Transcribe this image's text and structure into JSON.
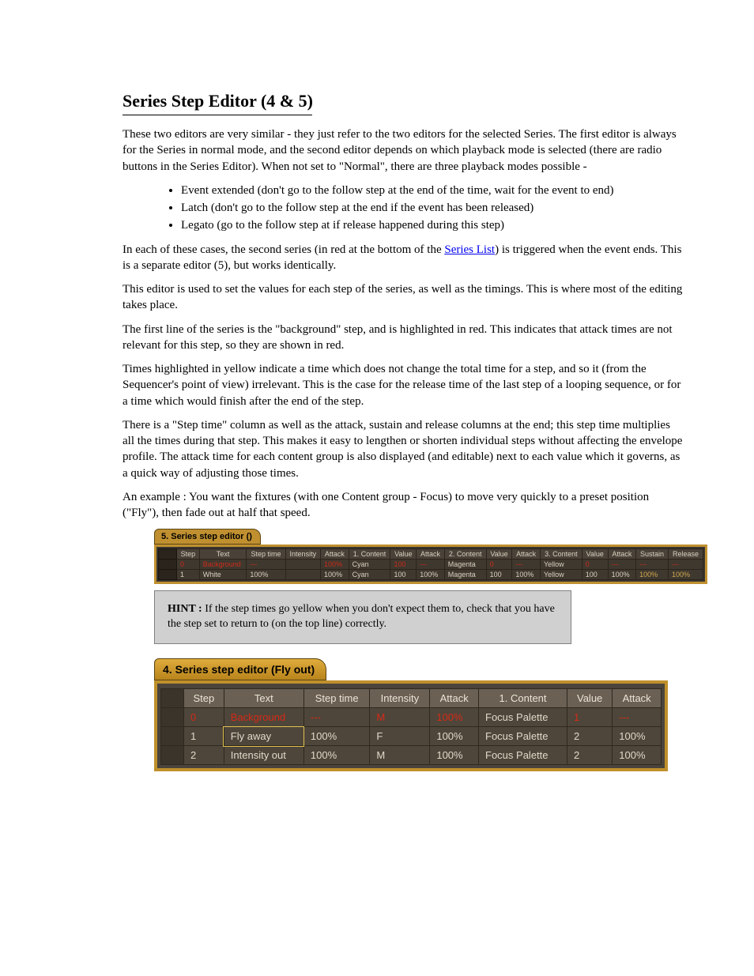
{
  "heading": "Series Step Editor (4 & 5)",
  "para1": "These two editors are very similar - they just refer to the two editors for the selected Series. The first editor is always for the Series in normal mode, and the second editor depends on which playback mode is selected (there are radio buttons in the Series Editor). When not set to \"Normal\", there are three playback modes possible -",
  "list": [
    "Event extended (don't go to the follow step at the end of the time, wait for the event to end)",
    "Latch (don't go to the follow step at the end if the event has been released)",
    "Legato (go to the follow step at if release happened during this step)"
  ],
  "para2_pre": "In each of these cases, the second series (in red at the bottom of the ",
  "para2_link": "Series List",
  "para2_post": ") is triggered when the event ends. This is a separate editor (5), but works identically.",
  "para3": "This editor is used to set the values for each step of the series, as well as the timings. This is where most of the editing takes place.",
  "para4": "The first line of the series is the \"background\" step, and is highlighted in red. This indicates that attack times are not relevant for this step, so they are shown in red.",
  "para5": "Times highlighted in yellow indicate a time which does not change the total time for a step, and so it (from the Sequencer's point of view) irrelevant. This is the case for the release time of the last step of a looping sequence, or for a time which would finish after the end of the step.",
  "para6": "There is a \"Step time\" column as well as the attack, sustain and release columns at the end; this step time multiplies all the times during that step. This makes it easy to lengthen or shorten individual steps without affecting the envelope profile. The attack time for each content group is also displayed (and editable) next to each value which it governs, as a quick way of adjusting those times.",
  "para7": "An example : You want the fixtures (with one Content group - Focus) to move very quickly to a preset position (\"Fly\"), then fade out at half that speed.",
  "shot1_title": "5. Series step editor ()",
  "shot1": {
    "headers": [
      "",
      "Step",
      "Text",
      "Step time",
      "Intensity",
      "Attack",
      "1. Content",
      "Value",
      "Attack",
      "2. Content",
      "Value",
      "Attack",
      "3. Content",
      "Value",
      "Attack",
      "Sustain",
      "Release"
    ],
    "rows": [
      {
        "swatch": "",
        "step": "0",
        "text": "Background",
        "stime": "---",
        "intens": "",
        "atk0": "100%",
        "c1": "Cyan",
        "v1": "100",
        "a1": "---",
        "c2": "Magenta",
        "v2": "0",
        "a2": "---",
        "c3": "Yellow",
        "v3": "0",
        "a3": "---",
        "sus": "---",
        "rel": "---",
        "special": "bg"
      },
      {
        "swatch": "",
        "step": "1",
        "text": "White",
        "stime": "100%",
        "intens": "",
        "atk0": "100%",
        "c1": "Cyan",
        "v1": "100",
        "a1": "100%",
        "c2": "Magenta",
        "v2": "100",
        "a2": "100%",
        "c3": "Yellow",
        "v3": "100",
        "a3": "100%",
        "sus": "100%",
        "rel": "100%",
        "special": "last"
      }
    ]
  },
  "hint_label": "HINT :",
  "hint_text": " If the step times go yellow when you don't expect them to, check that you have the step set to return to (on the top line) correctly.",
  "shot2_title": "4. Series step editor (Fly out)",
  "shot2": {
    "headers": [
      "",
      "Step",
      "Text",
      "Step time",
      "Intensity",
      "Attack",
      "1. Content",
      "Value",
      "Attack"
    ],
    "rows": [
      {
        "step": "0",
        "text": "Background",
        "stime": "---",
        "intens": "M",
        "atk": "100%",
        "c1": "Focus Palette",
        "v1": "1",
        "a1": "---",
        "special": "bg"
      },
      {
        "step": "1",
        "text": "Fly away",
        "stime": "100%",
        "intens": "F",
        "atk": "100%",
        "c1": "Focus Palette",
        "v1": "2",
        "a1": "100%",
        "special": "sel"
      },
      {
        "step": "2",
        "text": "Intensity out",
        "stime": "100%",
        "intens": "M",
        "atk": "100%",
        "c1": "Focus Palette",
        "v1": "2",
        "a1": "100%",
        "special": ""
      }
    ]
  }
}
